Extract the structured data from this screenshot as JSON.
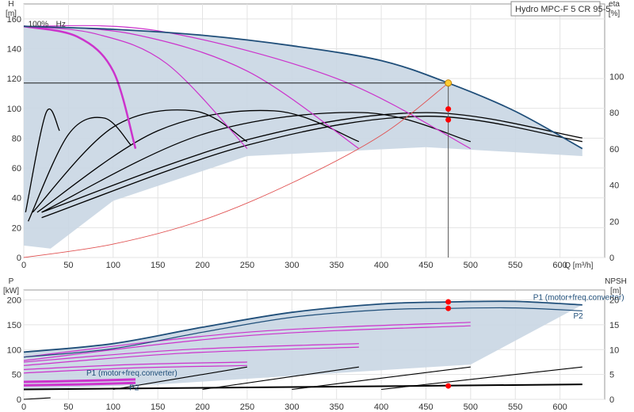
{
  "title": "Hydro MPC-F 5 CR 95-5",
  "colors": {
    "area": "#c9d6e3",
    "max_curve": "#1f4e79",
    "speed_curves": "#cc33cc",
    "eta_curves": "#000000",
    "system_curve": "#e05050",
    "duty_point": "#ff0000",
    "duty_marker": "#ffcc33"
  },
  "chart_data": [
    {
      "type": "line",
      "panel": "H-Q",
      "xlabel": "Q [m³/h]",
      "ylabel": "H [m]",
      "ylabel_right": "eta [%]",
      "xlim": [
        0,
        650
      ],
      "ylim": [
        0,
        170
      ],
      "ylim_right": [
        0,
        140
      ],
      "x_ticks": [
        0,
        50,
        100,
        150,
        200,
        250,
        300,
        350,
        400,
        450,
        500,
        550,
        600
      ],
      "y_ticks": [
        0,
        20,
        40,
        60,
        80,
        100,
        120,
        140,
        160
      ],
      "y_ticks_right": [
        0,
        20,
        40,
        60,
        80,
        100
      ],
      "annotations": [
        {
          "text": "100%",
          "x": 5,
          "y": 157
        },
        {
          "text": "Hz",
          "x": 36,
          "y": 157
        }
      ],
      "duty_point": {
        "q": 475,
        "h": 117
      },
      "system_curve": [
        [
          0,
          0
        ],
        [
          100,
          9
        ],
        [
          200,
          25
        ],
        [
          300,
          50
        ],
        [
          400,
          82
        ],
        [
          475,
          117
        ]
      ],
      "max_speed_curve": [
        [
          0,
          155
        ],
        [
          100,
          153
        ],
        [
          200,
          149
        ],
        [
          300,
          142
        ],
        [
          400,
          132
        ],
        [
          475,
          117
        ],
        [
          550,
          98
        ],
        [
          625,
          73
        ]
      ],
      "speed_curves": [
        [
          [
            0,
            155
          ],
          [
            60,
            148
          ],
          [
            100,
            125
          ],
          [
            125,
            73
          ]
        ],
        [
          [
            0,
            155
          ],
          [
            80,
            150
          ],
          [
            160,
            130
          ],
          [
            250,
            73
          ]
        ],
        [
          [
            0,
            155
          ],
          [
            120,
            150
          ],
          [
            250,
            125
          ],
          [
            375,
            73
          ]
        ],
        [
          [
            0,
            155
          ],
          [
            150,
            152
          ],
          [
            350,
            120
          ],
          [
            500,
            73
          ]
        ]
      ],
      "eta_curves": [
        [
          [
            2,
            25
          ],
          [
            25,
            80
          ],
          [
            40,
            70
          ]
        ],
        [
          [
            5,
            20
          ],
          [
            50,
            68
          ],
          [
            90,
            77
          ],
          [
            120,
            62
          ]
        ],
        [
          [
            10,
            25
          ],
          [
            100,
            72
          ],
          [
            190,
            81
          ],
          [
            250,
            64
          ]
        ],
        [
          [
            15,
            25
          ],
          [
            150,
            70
          ],
          [
            280,
            81
          ],
          [
            375,
            64
          ]
        ],
        [
          [
            20,
            25
          ],
          [
            200,
            68
          ],
          [
            380,
            80
          ],
          [
            500,
            64
          ]
        ],
        [
          [
            20,
            25
          ],
          [
            250,
            65
          ],
          [
            450,
            80
          ],
          [
            625,
            66
          ]
        ],
        [
          [
            20,
            22
          ],
          [
            250,
            62
          ],
          [
            450,
            78
          ],
          [
            625,
            64
          ]
        ]
      ]
    },
    {
      "type": "line",
      "panel": "P-Q",
      "ylabel": "P [kW]",
      "ylabel_right": "NPSH [m]",
      "xlim": [
        0,
        650
      ],
      "ylim": [
        0,
        220
      ],
      "ylim_right": [
        0,
        22
      ],
      "y_ticks": [
        0,
        50,
        100,
        150,
        200
      ],
      "y_ticks_right": [
        0,
        5,
        10,
        15,
        20
      ],
      "labels": [
        {
          "text": "P1 (motor+freq.converter)",
          "x": 570,
          "y": 200
        },
        {
          "text": "P2",
          "x": 615,
          "y": 163
        },
        {
          "text": "P1 (motor+freq.converter)",
          "x": 70,
          "y": 48
        },
        {
          "text": "P2",
          "x": 118,
          "y": 18
        }
      ],
      "duty_points": [
        {
          "q": 475,
          "p": 196
        },
        {
          "q": 475,
          "p": 183
        },
        {
          "q": 475,
          "p": 27
        }
      ],
      "p1_max": [
        [
          0,
          95
        ],
        [
          100,
          112
        ],
        [
          200,
          145
        ],
        [
          300,
          175
        ],
        [
          400,
          192
        ],
        [
          475,
          196
        ],
        [
          550,
          197
        ],
        [
          625,
          190
        ]
      ],
      "p2_max": [
        [
          0,
          85
        ],
        [
          100,
          102
        ],
        [
          200,
          135
        ],
        [
          300,
          165
        ],
        [
          400,
          180
        ],
        [
          475,
          183
        ],
        [
          550,
          184
        ],
        [
          625,
          178
        ]
      ],
      "speed_p_curves": [
        [
          [
            0,
            35
          ],
          [
            60,
            37
          ],
          [
            125,
            40
          ]
        ],
        [
          [
            0,
            60
          ],
          [
            120,
            70
          ],
          [
            250,
            75
          ]
        ],
        [
          [
            0,
            75
          ],
          [
            180,
            100
          ],
          [
            375,
            112
          ]
        ],
        [
          [
            0,
            85
          ],
          [
            250,
            135
          ],
          [
            500,
            155
          ]
        ]
      ],
      "npsh_curves": [
        [
          [
            0,
            0
          ],
          [
            30,
            3
          ]
        ],
        [
          [
            100,
            20
          ],
          [
            250,
            65
          ]
        ],
        [
          [
            200,
            20
          ],
          [
            375,
            65
          ]
        ],
        [
          [
            300,
            20
          ],
          [
            500,
            65
          ]
        ],
        [
          [
            400,
            20
          ],
          [
            625,
            65
          ]
        ]
      ]
    }
  ]
}
